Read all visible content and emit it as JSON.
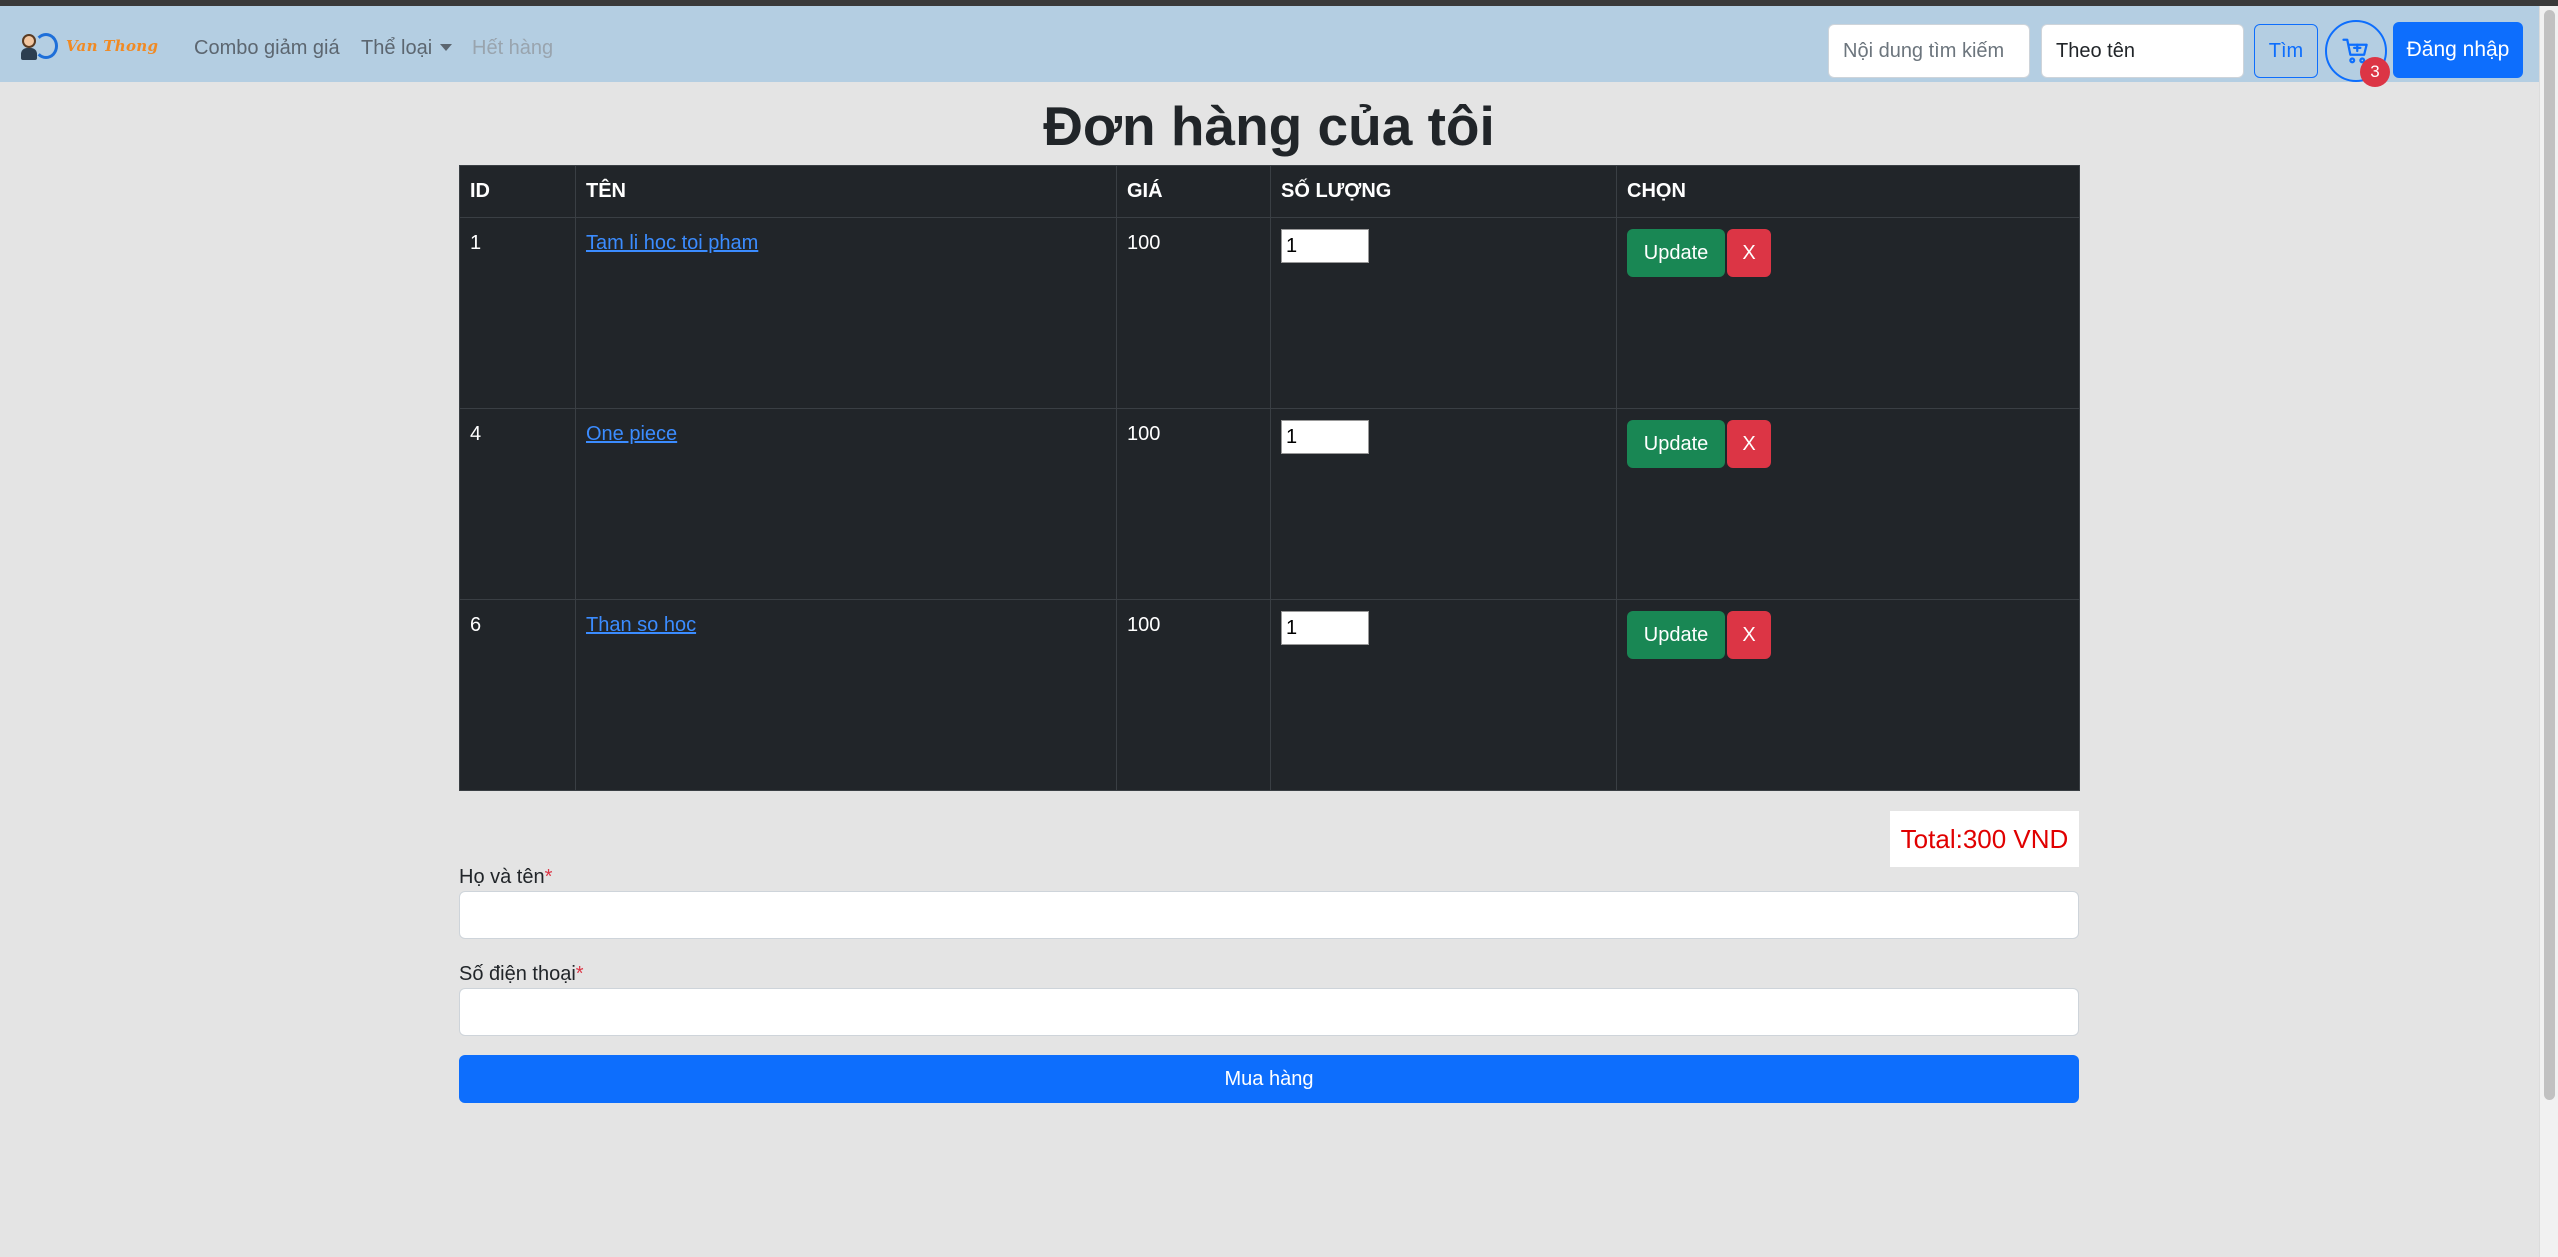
{
  "navbar": {
    "brand_text": "Van Thong",
    "links": [
      {
        "label": "Combo giảm giá"
      },
      {
        "label": "Thể loại"
      },
      {
        "label": "Hết hàng"
      }
    ],
    "search_placeholder": "Nội dung tìm kiếm",
    "search_by": "Theo tên",
    "search_button": "Tìm",
    "cart_count": "3",
    "login_button": "Đăng nhập"
  },
  "page_title": "Đơn hàng của tôi",
  "table": {
    "headers": [
      "ID",
      "TÊN",
      "GIÁ",
      "SỐ LƯỢNG",
      "CHỌN"
    ],
    "rows": [
      {
        "id": "1",
        "name": "Tam li hoc toi pham",
        "price": "100",
        "qty": "1"
      },
      {
        "id": "4",
        "name": "One piece",
        "price": "100",
        "qty": "1"
      },
      {
        "id": "6",
        "name": "Than so hoc",
        "price": "100",
        "qty": "1"
      }
    ],
    "update_label": "Update",
    "remove_label": "X"
  },
  "total": "Total:300 VND",
  "form": {
    "name_label": "Họ và tên",
    "phone_label": "Số điện thoại",
    "required_mark": "*",
    "submit_label": "Mua hàng"
  },
  "colors": {
    "navbar_bg": "#b4cee2",
    "primary": "#0d6efd",
    "success": "#198754",
    "danger": "#dc3545",
    "table_bg": "#212529",
    "page_bg": "#e4e4e4"
  }
}
